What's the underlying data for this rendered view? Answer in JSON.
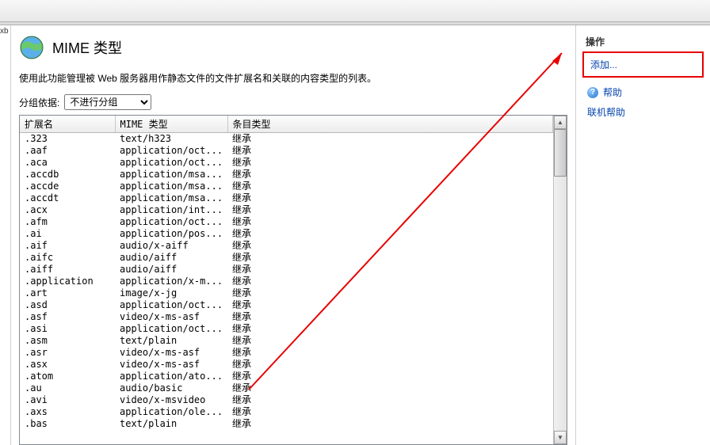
{
  "left_sliver": "xb",
  "header": {
    "title": "MIME 类型",
    "description": "使用此功能管理被 Web 服务器用作静态文件的文件扩展名和关联的内容类型的列表。"
  },
  "grouping": {
    "label": "分组依据:",
    "selected": "不进行分组"
  },
  "columns": {
    "ext": "扩展名",
    "mime": "MIME 类型",
    "entry": "条目类型"
  },
  "rows": [
    {
      "ext": ".323",
      "mime": "text/h323",
      "entry": "继承"
    },
    {
      "ext": ".aaf",
      "mime": "application/oct...",
      "entry": "继承"
    },
    {
      "ext": ".aca",
      "mime": "application/oct...",
      "entry": "继承"
    },
    {
      "ext": ".accdb",
      "mime": "application/msa...",
      "entry": "继承"
    },
    {
      "ext": ".accde",
      "mime": "application/msa...",
      "entry": "继承"
    },
    {
      "ext": ".accdt",
      "mime": "application/msa...",
      "entry": "继承"
    },
    {
      "ext": ".acx",
      "mime": "application/int...",
      "entry": "继承"
    },
    {
      "ext": ".afm",
      "mime": "application/oct...",
      "entry": "继承"
    },
    {
      "ext": ".ai",
      "mime": "application/pos...",
      "entry": "继承"
    },
    {
      "ext": ".aif",
      "mime": "audio/x-aiff",
      "entry": "继承"
    },
    {
      "ext": ".aifc",
      "mime": "audio/aiff",
      "entry": "继承"
    },
    {
      "ext": ".aiff",
      "mime": "audio/aiff",
      "entry": "继承"
    },
    {
      "ext": ".application",
      "mime": "application/x-m...",
      "entry": "继承"
    },
    {
      "ext": ".art",
      "mime": "image/x-jg",
      "entry": "继承"
    },
    {
      "ext": ".asd",
      "mime": "application/oct...",
      "entry": "继承"
    },
    {
      "ext": ".asf",
      "mime": "video/x-ms-asf",
      "entry": "继承"
    },
    {
      "ext": ".asi",
      "mime": "application/oct...",
      "entry": "继承"
    },
    {
      "ext": ".asm",
      "mime": "text/plain",
      "entry": "继承"
    },
    {
      "ext": ".asr",
      "mime": "video/x-ms-asf",
      "entry": "继承"
    },
    {
      "ext": ".asx",
      "mime": "video/x-ms-asf",
      "entry": "继承"
    },
    {
      "ext": ".atom",
      "mime": "application/ato...",
      "entry": "继承"
    },
    {
      "ext": ".au",
      "mime": "audio/basic",
      "entry": "继承"
    },
    {
      "ext": ".avi",
      "mime": "video/x-msvideo",
      "entry": "继承"
    },
    {
      "ext": ".axs",
      "mime": "application/ole...",
      "entry": "继承"
    },
    {
      "ext": ".bas",
      "mime": "text/plain",
      "entry": "继承"
    }
  ],
  "actions": {
    "panel_title": "操作",
    "add": "添加...",
    "help": "帮助",
    "online_help": "联机帮助"
  }
}
